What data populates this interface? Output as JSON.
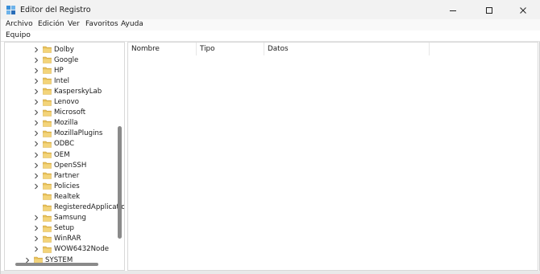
{
  "window": {
    "title": "Editor del Registro"
  },
  "menu": {
    "items": [
      "Archivo",
      "Edición",
      "Ver",
      "Favoritos",
      "Ayuda"
    ]
  },
  "address": {
    "path": "Equipo"
  },
  "tree": {
    "items": [
      {
        "label": "Dolby"
      },
      {
        "label": "Google"
      },
      {
        "label": "HP"
      },
      {
        "label": "Intel"
      },
      {
        "label": "KasperskyLab"
      },
      {
        "label": "Lenovo"
      },
      {
        "label": "Microsoft"
      },
      {
        "label": "Mozilla"
      },
      {
        "label": "MozillaPlugins"
      },
      {
        "label": "ODBC"
      },
      {
        "label": "OEM"
      },
      {
        "label": "OpenSSH"
      },
      {
        "label": "Partner"
      },
      {
        "label": "Policies"
      },
      {
        "label": "Realtek"
      },
      {
        "label": "RegisteredApplication"
      },
      {
        "label": "Samsung"
      },
      {
        "label": "Setup"
      },
      {
        "label": "WinRAR"
      },
      {
        "label": "WOW6432Node"
      },
      {
        "label": "SYSTEM"
      }
    ]
  },
  "list": {
    "columns": [
      "Nombre",
      "Tipo",
      "Datos"
    ]
  },
  "colors": {
    "folder": "#e8c15a",
    "folder_dark": "#c99a2e",
    "scrollbar": "#8a8a8a"
  }
}
